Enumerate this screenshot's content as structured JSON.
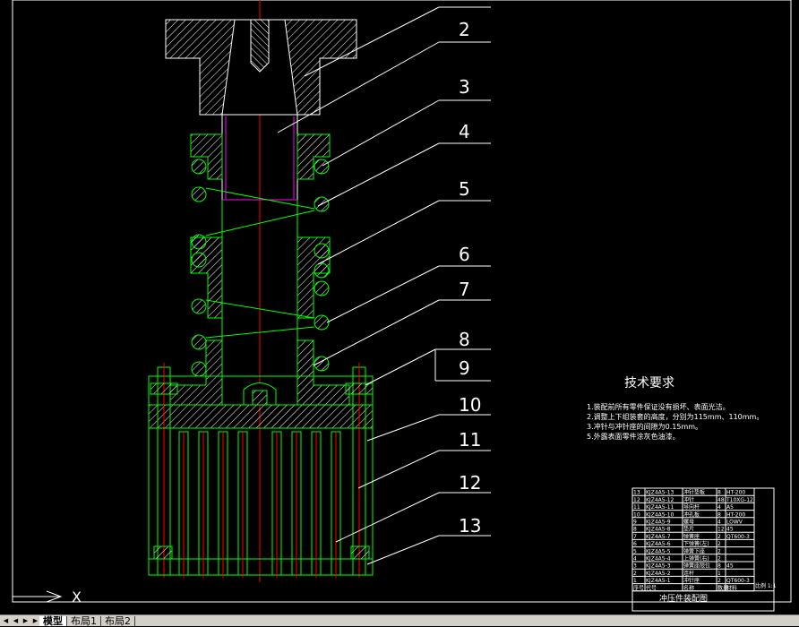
{
  "drawing": {
    "part_labels": [
      "2",
      "3",
      "4",
      "5",
      "6",
      "7",
      "8",
      "9",
      "10",
      "11",
      "12",
      "13"
    ],
    "axis_label": "X",
    "tech_title": "技术要求",
    "tech_notes": [
      "1.装配前所有零件保证没有损坏、表面光洁。",
      "2.调整上下组装套的高度，分别为115mm、110mm。",
      "3.冲针与冲针座的间隙为0.15mm。",
      "5.外露表面零件涂灰色油漆。"
    ]
  },
  "bom": {
    "rows": [
      {
        "no": "13",
        "code": "KJZ4A5-13",
        "name": "冲针垫板",
        "qty": "8",
        "mat": "HT-200"
      },
      {
        "no": "12",
        "code": "KJZ4A5-12",
        "name": "冲针",
        "qty": "48",
        "mat": "T10XG-12"
      },
      {
        "no": "11",
        "code": "KJZ4A5-11",
        "name": "导向杆",
        "qty": "4",
        "mat": "A5"
      },
      {
        "no": "10",
        "code": "KJZ4A5-10",
        "name": "冲孔板",
        "qty": "8",
        "mat": "HT-200"
      },
      {
        "no": "9",
        "code": "KJZ4A5-9",
        "name": "螺母",
        "qty": "4",
        "mat": "LOWV"
      },
      {
        "no": "8",
        "code": "KJZ4A5-8",
        "name": "垫片",
        "qty": "12",
        "mat": "45"
      },
      {
        "no": "7",
        "code": "KJZ4A5-7",
        "name": "弹簧座",
        "qty": "2",
        "mat": "QT600-3"
      },
      {
        "no": "6",
        "code": "KJZ4A5-6",
        "name": "下弹簧(左)",
        "qty": "2",
        "mat": ""
      },
      {
        "no": "5",
        "code": "KJZ4A5-5",
        "name": "弹簧下座",
        "qty": "2",
        "mat": ""
      },
      {
        "no": "4",
        "code": "KJZ4A5-4",
        "name": "上弹簧(右)",
        "qty": "2",
        "mat": ""
      },
      {
        "no": "3",
        "code": "KJZ4A5-3",
        "name": "弹簧座限位",
        "qty": "8",
        "mat": "45"
      },
      {
        "no": "2",
        "code": "KJZ4A5-2",
        "name": "连杆",
        "qty": "1",
        "mat": ""
      },
      {
        "no": "1",
        "code": "KJZ4A5-1",
        "name": "冲针座",
        "qty": "2",
        "mat": "QT600-3"
      }
    ],
    "header": {
      "no": "序号",
      "code": "代号",
      "name": "名称",
      "qty": "数量",
      "mat": "材料",
      "remark": "备注"
    },
    "title": "冲压件装配图",
    "scale_label": "比例",
    "scale_value": "1:1"
  },
  "tabs": {
    "items": [
      "模型",
      "布局1",
      "布局2"
    ],
    "active": "模型"
  },
  "colors": {
    "background": "#000000",
    "green": "#00ff00",
    "white": "#ffffff",
    "red": "#ff0000",
    "magenta": "#ff00ff"
  }
}
